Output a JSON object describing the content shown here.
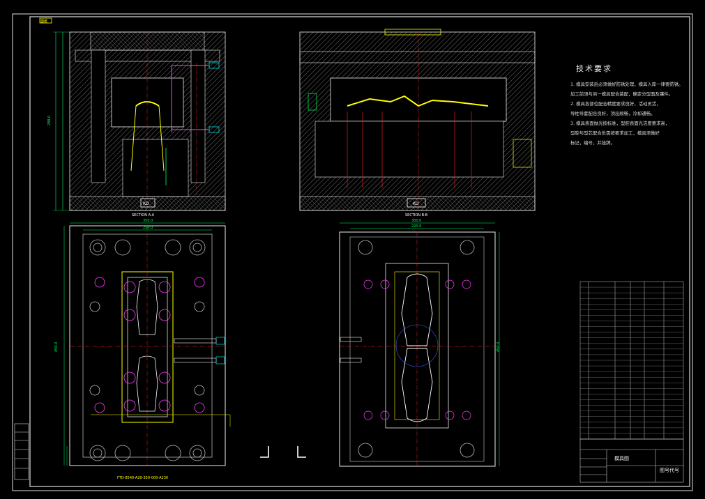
{
  "drawing": {
    "frame_tag": "图纸",
    "section_a_label": "SECTION A-A",
    "section_b_label": "SECTION B-B",
    "kd_a": "KD",
    "kd_b": "KD",
    "bottom_part_code": "FTD-8540-A20-350-000-A230",
    "dim_a_total": "350.0",
    "dim_a_inner": "250.0",
    "dim_b_total": "300.0",
    "dim_b_inner": "220.0",
    "dim_a_height": "450.0",
    "dim_b_height": "450.0",
    "dim_side_total": "288.0"
  },
  "notes": {
    "title": "技术要求",
    "lines": [
      "1. 模具安装后必须做好防锈处理，模具入库一律要防锈。",
      "   加工前须与另一模具配合装配，确定分型面及镶件。",
      "2. 模具各部位配合精度要求良好，活动灵活，",
      "   导柱导套配合良好，顶出顺畅，冷却通畅。",
      "3. 模具表面抛光按标准，型腔表面光洁度要求高，",
      "   型腔与型芯配合处需按要求加工，模具须做好",
      "   标记，编号，并挂牌。"
    ]
  },
  "title_block": {
    "company": "模具图",
    "drawing_no": "图号代号"
  },
  "colors": {
    "frame": "#ffffff",
    "hatch": "#ffffff",
    "centerline": "#ff2020",
    "dimension": "#00ff60",
    "yellow": "#ffff00",
    "cyan": "#00ffff",
    "magenta": "#ff40ff",
    "blue": "#4060ff",
    "background": "#000000"
  }
}
